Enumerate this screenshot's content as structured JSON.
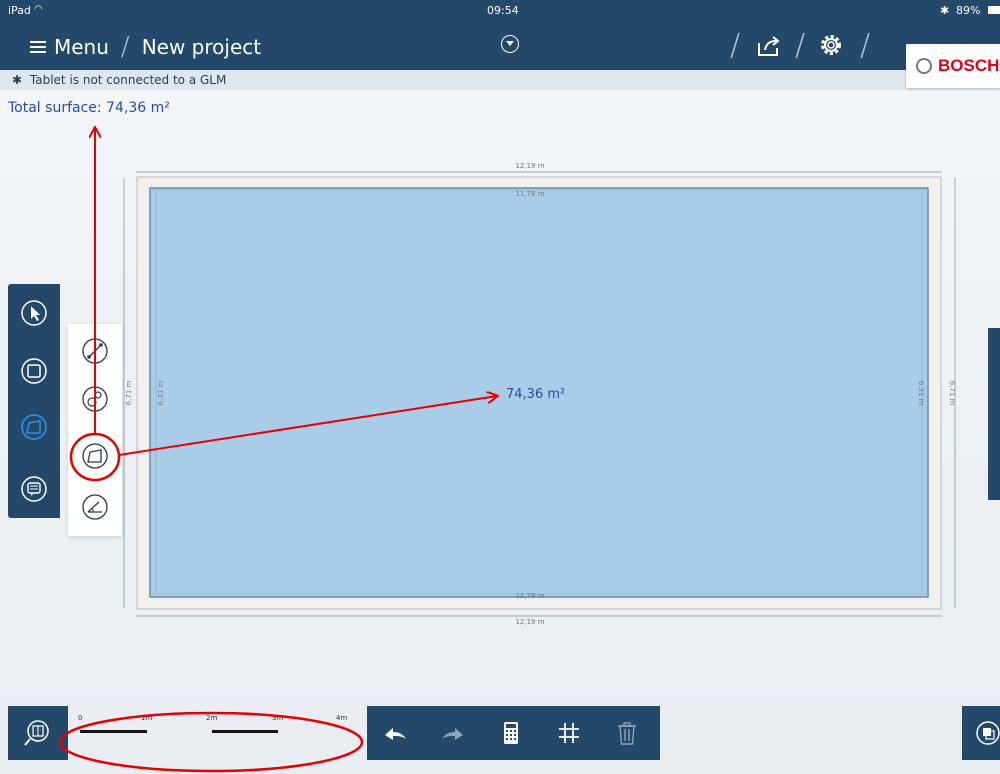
{
  "status_bar": {
    "device": "iPad",
    "time": "09:54",
    "battery": "89%"
  },
  "nav": {
    "menu_label": "Menu",
    "project_title": "New project"
  },
  "brand": {
    "name": "BOSCH"
  },
  "connection": {
    "bt_glyph": "✱",
    "message": "Tablet is not connected to a GLM"
  },
  "summary": {
    "total_surface": "Total surface: 74,36 m²"
  },
  "room": {
    "area_label": "74,36 m²",
    "outer_width": "12,19 m",
    "inner_width": "11,78 m",
    "outer_height": "6,71 m",
    "inner_height": "6,31 m"
  },
  "scale": {
    "labels": [
      "0",
      "1m",
      "2m",
      "3m",
      "4m"
    ]
  },
  "colors": {
    "nav_bg": "#23486a",
    "room_fill": "#a9cce8",
    "wall_fill": "#f1f0ec",
    "accent_blue": "#2c4aa6",
    "active_tool": "#2e8fd8",
    "annotation_red": "#e60000"
  },
  "icons": {
    "left_toolbar": [
      "pointer-icon",
      "wall-shape-icon",
      "surface-tool-icon",
      "comment-icon"
    ],
    "shape_palette": [
      "line-measure-icon",
      "circle-measure-icon",
      "area-measure-icon",
      "angle-measure-icon"
    ],
    "bottom_toolbar": [
      "undo-icon",
      "redo-icon",
      "calculator-icon",
      "grid-icon",
      "delete-icon"
    ]
  }
}
